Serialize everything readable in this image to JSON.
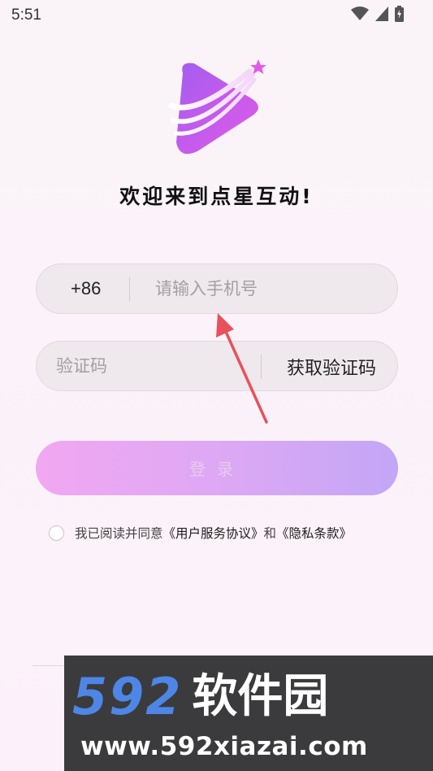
{
  "status_bar": {
    "time": "5:51"
  },
  "welcome_title": "欢迎来到点星互动!",
  "phone_field": {
    "country_code": "+86",
    "placeholder": "请输入手机号"
  },
  "code_field": {
    "placeholder": "验证码",
    "get_code_label": "获取验证码"
  },
  "login_button": "登录",
  "agreement": {
    "prefix": "我已阅读并同意",
    "user_agreement": "《用户服务协议》",
    "and": "和",
    "privacy": "《隐私条款》"
  },
  "watermark": {
    "brand_number": "592",
    "brand_name": "软件园",
    "url": "www.592xiazai.com"
  },
  "colors": {
    "accent_gradient_start": "#f2a7f2",
    "accent_gradient_end": "#c3a6f6",
    "logo_purple": "#a45cf0",
    "logo_pink": "#e25ae8"
  }
}
